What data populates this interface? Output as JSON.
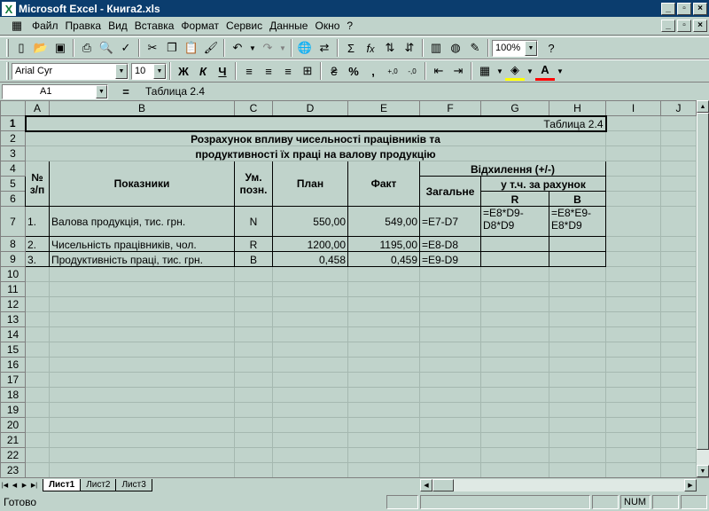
{
  "window": {
    "title": "Microsoft Excel - Книга2.xls",
    "app_icon": "X",
    "min": "_",
    "restore": "▫",
    "close": "×"
  },
  "menu": {
    "items": [
      "Файл",
      "Правка",
      "Вид",
      "Вставка",
      "Формат",
      "Сервис",
      "Данные",
      "Окно",
      "?"
    ],
    "hotkeys": [
      "Ф",
      "П",
      "В",
      "а",
      "о",
      "С",
      "Д",
      "О",
      "?"
    ]
  },
  "toolbar1": {
    "zoom": "100%",
    "icons": [
      "new-icon",
      "open-icon",
      "save-icon",
      "print-icon",
      "print-preview-icon",
      "spelling-icon",
      "cut-icon",
      "copy-icon",
      "paste-icon",
      "format-painter-icon",
      "undo-icon",
      "redo-icon",
      "hyperlink-icon",
      "web-toolbar-icon",
      "autosum-icon",
      "function-icon",
      "sort-ascending-icon",
      "sort-descending-icon",
      "chart-wizard-icon",
      "map-icon",
      "drawing-icon",
      "help-icon"
    ]
  },
  "toolbar2": {
    "font": "Arial Cyr",
    "size": "10",
    "bold": "Ж",
    "italic": "К",
    "underline": "Ч",
    "currency": "₴",
    "percent": "%",
    "comma": ",",
    "inc_decimal": "+,0",
    "dec_decimal": "-,0"
  },
  "formula_bar": {
    "name_box": "A1",
    "equals": "=",
    "content": "Таблица 2.4"
  },
  "columns": [
    "A",
    "B",
    "C",
    "D",
    "E",
    "F",
    "G",
    "H",
    "I",
    "J"
  ],
  "rows": [
    "1",
    "2",
    "3",
    "4",
    "5",
    "6",
    "7",
    "8",
    "9",
    "10",
    "11",
    "12",
    "13",
    "14",
    "15",
    "16",
    "17",
    "18",
    "19",
    "20",
    "21",
    "22",
    "23"
  ],
  "sheet": {
    "r1_label": "Таблица 2.4",
    "title_line1": "Розрахунок впливу чисельності працівників та",
    "title_line2": "продуктивності їх праці на валову продукцію",
    "h_num": "№ з/п",
    "h_indicators": "Показники",
    "h_unit": "Ум. позн.",
    "h_plan": "План",
    "h_fact": "Факт",
    "h_deviation": "Відхилення (+/-)",
    "h_total": "Загальне",
    "h_including": "у т.ч. за рахунок",
    "h_r": "R",
    "h_b": "B",
    "data": [
      {
        "num": "1.",
        "name": "Валова продукція, тис. грн.",
        "unit": "N",
        "plan": "550,00",
        "fact": "549,00",
        "total": "=E7-D7",
        "r": "=E8*D9-D8*D9",
        "b": "=E8*E9-E8*D9"
      },
      {
        "num": "2.",
        "name": "Чисельність працівників, чол.",
        "unit": "R",
        "plan": "1200,00",
        "fact": "1195,00",
        "total": "=E8-D8",
        "r": "",
        "b": ""
      },
      {
        "num": "3.",
        "name": "Продуктивність праці, тис. грн.",
        "unit": "B",
        "plan": "0,458",
        "fact": "0,459",
        "total": "=E9-D9",
        "r": "",
        "b": ""
      }
    ]
  },
  "tabs": {
    "nav": [
      "|◀",
      "◀",
      "▶",
      "▶|"
    ],
    "sheets": [
      "Лист1",
      "Лист2",
      "Лист3"
    ]
  },
  "status": {
    "text": "Готово",
    "num": "NUM"
  }
}
